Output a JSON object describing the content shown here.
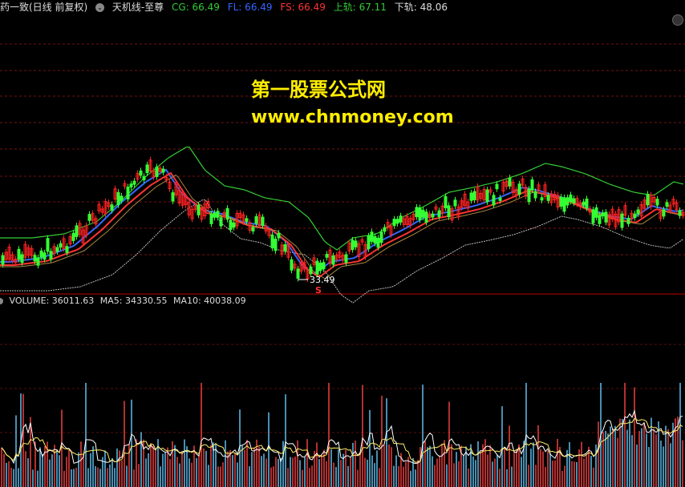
{
  "header": {
    "stock_title": "药一致(日线 前复权)",
    "indicator_name": "天机线-至尊",
    "cg_label": "CG: 66.49",
    "fl_label": "FL: 66.49",
    "fs_label": "FS: 66.49",
    "upper_label": "上轨: 67.11",
    "lower_label": "下轨: 48.06"
  },
  "watermark": {
    "line1": "第一股票公式网",
    "line2": "www.chnmoney.com"
  },
  "price_chart": {
    "low_marker_label": "33.49",
    "signal_mark": "S"
  },
  "volume_header": {
    "volume_label": "VOLUME: 36011.63",
    "ma5_label": "MA5: 34330.55",
    "ma10_label": "MA10: 40038.09"
  },
  "colors": {
    "cg": "#33cc33",
    "fl": "#3366ff",
    "fs": "#ff3333",
    "upper": "#33cc33",
    "lower": "#ffffff",
    "up_candle": "#ff2222",
    "down_candle": "#33ff33",
    "separator": "#c00000"
  }
}
